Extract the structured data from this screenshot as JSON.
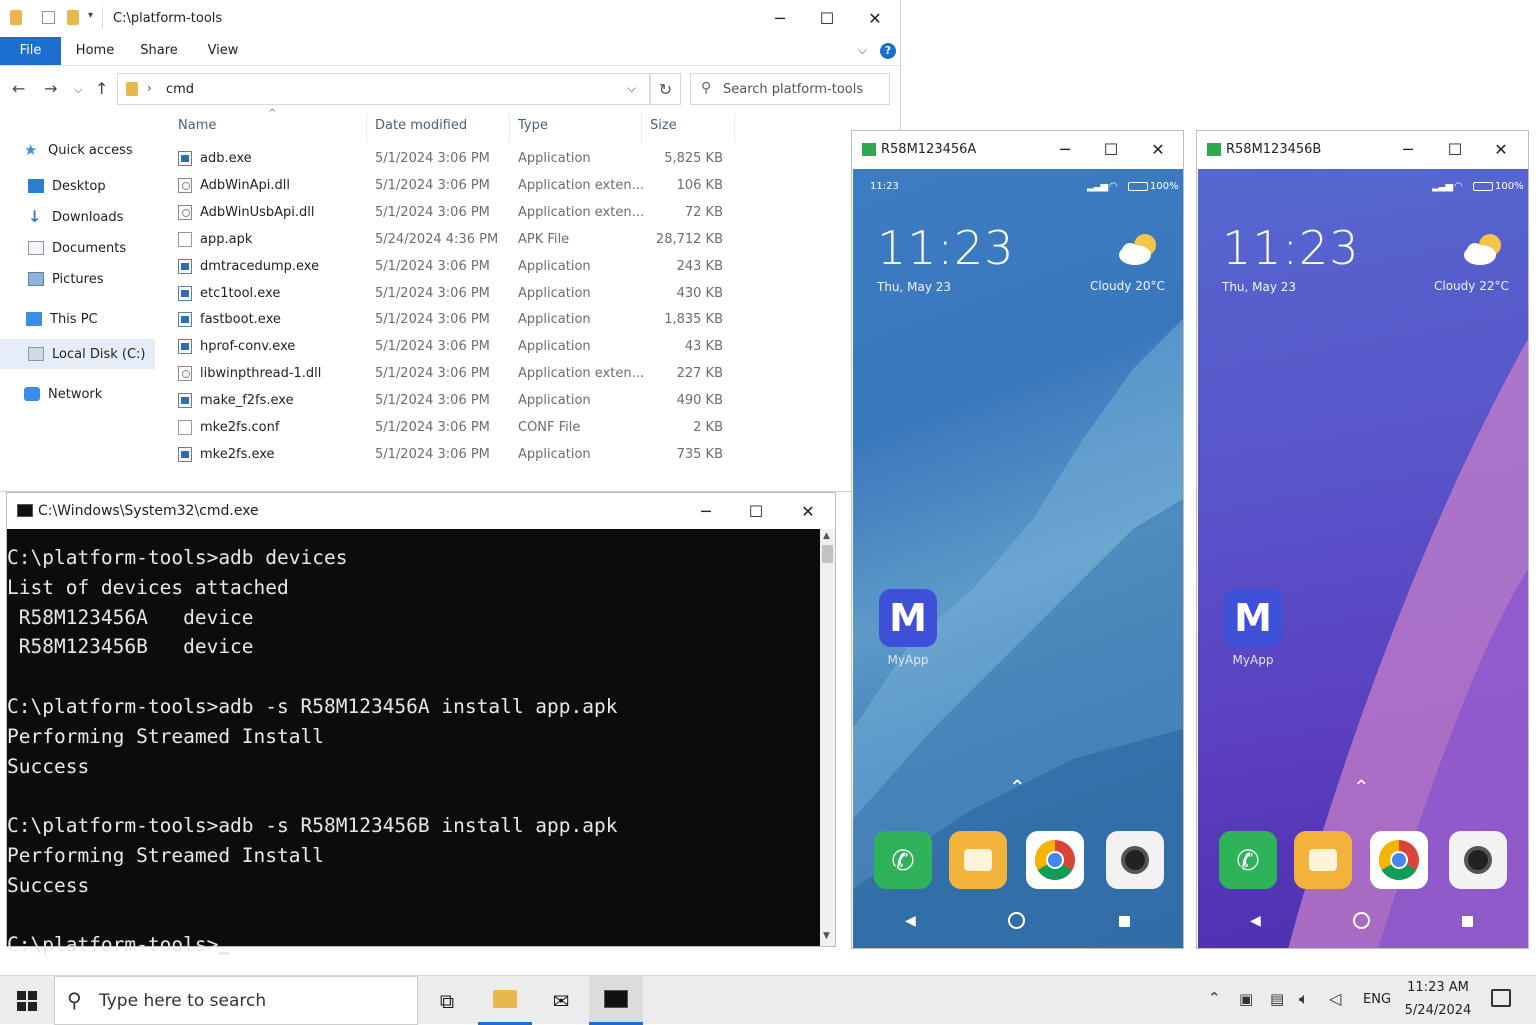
{
  "explorer": {
    "title_path": "C:\\platform-tools",
    "ribbon_tabs": [
      "File",
      "Home",
      "Share",
      "View"
    ],
    "address_folder": "cmd",
    "search_placeholder": "Search platform-tools",
    "sidebar": [
      "Quick access",
      "Desktop",
      "Downloads",
      "Documents",
      "Pictures",
      "This PC",
      "Local Disk (C:)",
      "Network"
    ],
    "columns": [
      "Name",
      "Date modified",
      "Type",
      "Size"
    ],
    "files": [
      {
        "name": "adb.exe",
        "date": "5/1/2024 3:06 PM",
        "type": "Application",
        "size": "5,825 KB",
        "icon": "exe"
      },
      {
        "name": "AdbWinApi.dll",
        "date": "5/1/2024 3:06 PM",
        "type": "Application exten...",
        "size": "106 KB",
        "icon": "dll"
      },
      {
        "name": "AdbWinUsbApi.dll",
        "date": "5/1/2024 3:06 PM",
        "type": "Application exten...",
        "size": "72 KB",
        "icon": "dll"
      },
      {
        "name": "app.apk",
        "date": "5/24/2024 4:36 PM",
        "type": "APK File",
        "size": "28,712 KB",
        "icon": "doc"
      },
      {
        "name": "dmtracedump.exe",
        "date": "5/1/2024 3:06 PM",
        "type": "Application",
        "size": "243 KB",
        "icon": "exe"
      },
      {
        "name": "etc1tool.exe",
        "date": "5/1/2024 3:06 PM",
        "type": "Application",
        "size": "430 KB",
        "icon": "exe"
      },
      {
        "name": "fastboot.exe",
        "date": "5/1/2024 3:06 PM",
        "type": "Application",
        "size": "1,835 KB",
        "icon": "exe"
      },
      {
        "name": "hprof-conv.exe",
        "date": "5/1/2024 3:06 PM",
        "type": "Application",
        "size": "43 KB",
        "icon": "exe"
      },
      {
        "name": "libwinpthread-1.dll",
        "date": "5/1/2024 3:06 PM",
        "type": "Application exten...",
        "size": "227 KB",
        "icon": "dll"
      },
      {
        "name": "make_f2fs.exe",
        "date": "5/1/2024 3:06 PM",
        "type": "Application",
        "size": "490 KB",
        "icon": "exe"
      },
      {
        "name": "mke2fs.conf",
        "date": "5/1/2024 3:06 PM",
        "type": "CONF File",
        "size": "2 KB",
        "icon": "doc"
      },
      {
        "name": "mke2fs.exe",
        "date": "5/1/2024 3:06 PM",
        "type": "Application",
        "size": "735 KB",
        "icon": "exe"
      }
    ]
  },
  "cmd": {
    "title": "C:\\Windows\\System32\\cmd.exe",
    "lines": [
      "C:\\platform-tools>adb devices",
      "List of devices attached",
      " R58M123456A   device",
      " R58M123456B   device",
      "",
      "C:\\platform-tools>adb -s R58M123456A install app.apk",
      "Performing Streamed Install",
      "Success",
      "",
      "C:\\platform-tools>adb -s R58M123456B install app.apk",
      "Performing Streamed Install",
      "Success",
      "",
      "C:\\platform-tools>"
    ]
  },
  "phones": [
    {
      "title": "R58M123456A",
      "status_time": "11:23",
      "battery": "100%",
      "clock": "11:23",
      "date": "Thu, May 23",
      "weather": "Cloudy  20°C",
      "app_label": "MyApp",
      "app_letter": "M"
    },
    {
      "title": "R58M123456B",
      "status_time": "",
      "battery": "100%",
      "clock": "11:23",
      "date": "Thu, May 23",
      "weather": "Cloudy  22°C",
      "app_label": "MyApp",
      "app_letter": "M"
    }
  ],
  "taskbar": {
    "search_placeholder": "Type here to search",
    "language": "ENG",
    "time": "11:23 AM",
    "date": "5/24/2024"
  },
  "colors": {
    "accent": "#1c6fcf",
    "phone_a_bg": "#2f6fb3",
    "phone_b_bg": "#5a48c8"
  }
}
